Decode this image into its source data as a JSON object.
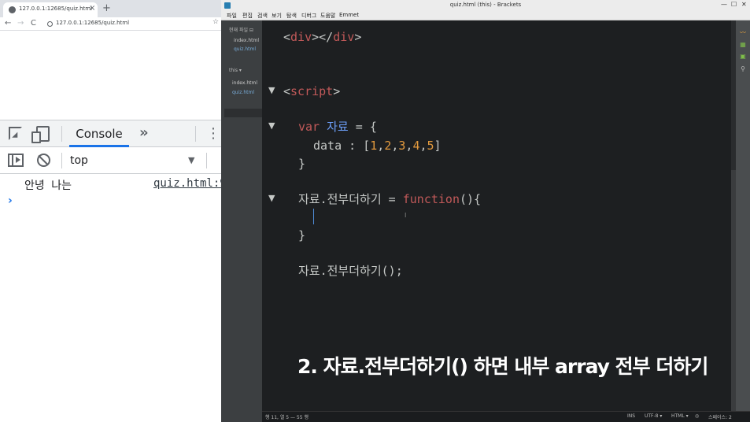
{
  "browser": {
    "tab_title": "127.0.0.1:12685/quiz.html",
    "tab_close": "×",
    "new_tab": "+",
    "back": "←",
    "forward": "→",
    "reload": "C",
    "url": "127.0.0.1:12685/quiz.html",
    "star": "☆"
  },
  "devtools": {
    "console_tab": "Console",
    "more_tabs": "»",
    "kebab": "⋮",
    "context": "top",
    "context_arrow": "▼",
    "log_message": "안녕 나는",
    "log_source": "quiz.html:9",
    "prompt": "›"
  },
  "brackets": {
    "title": "quiz.html (this) - Brackets",
    "win_min": "—",
    "win_max": "☐",
    "win_close": "✕",
    "menu": [
      "파일",
      "편집",
      "검색",
      "보기",
      "탐색",
      "디버그",
      "도움말",
      "Emmet"
    ],
    "sidebar": {
      "working_files_header": "현재 파일 ⊟",
      "working_files": [
        "index.html",
        "quiz.html"
      ],
      "project_header": "this ▾",
      "project_files": [
        "index.html",
        "quiz.html"
      ]
    },
    "code": {
      "line_div": [
        "<",
        "div",
        "></",
        "div",
        ">"
      ],
      "line_script": [
        "<",
        "script",
        ">"
      ],
      "line_var": [
        "var",
        " ",
        "자료",
        " = {"
      ],
      "line_data": [
        "data : [",
        "1",
        ",",
        "2",
        ",",
        "3",
        ",",
        "4",
        ",",
        "5",
        "]"
      ],
      "line_close1": "}",
      "line_func": [
        "자료.전부더하기 = ",
        "function",
        "(){"
      ],
      "line_close2": "}",
      "line_call": "자료.전부더하기();",
      "fold_marker": "▼"
    },
    "caption": "2. 자료.전부더하기() 하면 내부 array 전부 더하기",
    "status": {
      "position": "행 11, 열 5 — 55 행",
      "ins": "INS",
      "encoding": "UTF-8 ▾",
      "language": "HTML ▾",
      "lint": "◎",
      "spaces": "스페이스: 2"
    },
    "colors": {
      "tag": "#c15959",
      "keyword": "#c15959",
      "var_name": "#6c9ef8",
      "number": "#e39a3e",
      "text": "#c5c8c6",
      "caret": "#4f8cd6"
    }
  }
}
